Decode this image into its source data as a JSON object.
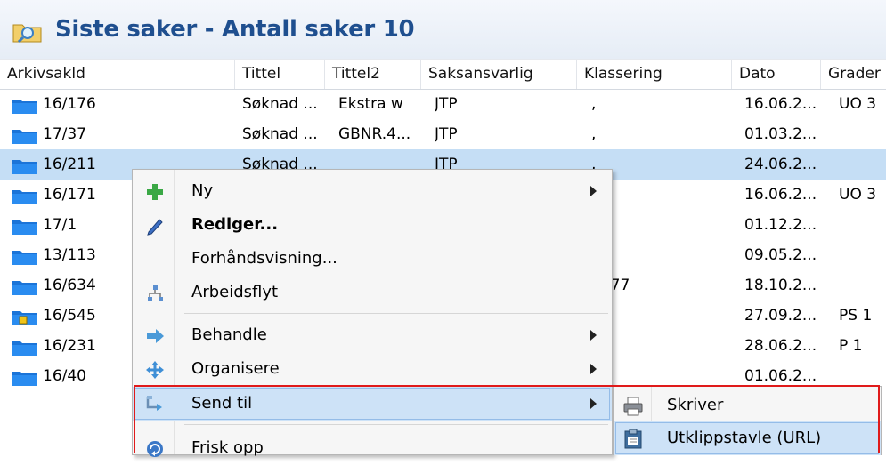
{
  "window": {
    "title": "Siste saker - Antall saker 10",
    "title_icon": "search-folder-icon"
  },
  "table": {
    "columns": [
      "Arkivsakld",
      "Tittel",
      "Tittel2",
      "Saksansvarlig",
      "Klassering",
      "Dato",
      "Grader"
    ],
    "rows": [
      {
        "id": "16/176",
        "tittel": "Søknad ...",
        "tittel2": "Ekstra w",
        "saksansvarlig": "JTP",
        "klassering": ",",
        "dato": "16.06.2...",
        "grader": "UO 3",
        "icon": "folder-icon"
      },
      {
        "id": "17/37",
        "tittel": "Søknad ...",
        "tittel2": "GBNR.4...",
        "saksansvarlig": "JTP",
        "klassering": ",",
        "dato": "01.03.2...",
        "grader": "",
        "icon": "folder-icon"
      },
      {
        "id": "16/211",
        "tittel": "Søknad ...",
        "tittel2": "",
        "saksansvarlig": "JTP",
        "klassering": ",",
        "dato": "24.06.2...",
        "grader": "",
        "icon": "folder-icon",
        "selected": true
      },
      {
        "id": "16/171",
        "tittel": "",
        "tittel2": "",
        "saksansvarlig": "",
        "klassering": "",
        "dato": "16.06.2...",
        "grader": "UO 3",
        "icon": "folder-icon"
      },
      {
        "id": "17/1",
        "tittel": "",
        "tittel2": "",
        "saksansvarlig": "",
        "klassering": "",
        "dato": "01.12.2...",
        "grader": "",
        "icon": "folder-icon"
      },
      {
        "id": "13/113",
        "tittel": "",
        "tittel2": "",
        "saksansvarlig": "",
        "klassering": "",
        "dato": "09.05.2...",
        "grader": "",
        "icon": "folder-icon"
      },
      {
        "id": "16/634",
        "tittel": "",
        "tittel2": "",
        "saksansvarlig": "",
        "klassering": "4, 77",
        "dato": "18.10.2...",
        "grader": "",
        "icon": "folder-icon"
      },
      {
        "id": "16/545",
        "tittel": "",
        "tittel2": "",
        "saksansvarlig": "",
        "klassering": "",
        "dato": "27.09.2...",
        "grader": "PS 1",
        "icon": "locked-folder-icon"
      },
      {
        "id": "16/231",
        "tittel": "",
        "tittel2": "",
        "saksansvarlig": "",
        "klassering": "",
        "dato": "28.06.2...",
        "grader": "P 1",
        "icon": "folder-icon"
      },
      {
        "id": "16/40",
        "tittel": "",
        "tittel2": "",
        "saksansvarlig": "",
        "klassering": "",
        "dato": "01.06.2...",
        "grader": "",
        "icon": "folder-icon"
      }
    ]
  },
  "context_menu": {
    "items": [
      {
        "label": "Ny",
        "icon": "plus-icon",
        "submenu": true
      },
      {
        "label": "Rediger...",
        "icon": "pencil-icon",
        "bold": true
      },
      {
        "label": "Forhåndsvisning...",
        "icon": ""
      },
      {
        "label": "Arbeidsflyt",
        "icon": "workflow-icon"
      },
      {
        "label": "Behandle",
        "icon": "forward-arrow-icon",
        "submenu": true
      },
      {
        "label": "Organisere",
        "icon": "move-arrows-icon",
        "submenu": true
      },
      {
        "label": "Send til",
        "icon": "send-to-icon",
        "submenu": true,
        "highlighted": true
      },
      {
        "label": "Frisk opp",
        "icon": "refresh-icon"
      }
    ]
  },
  "submenu": {
    "items": [
      {
        "label": "Skriver",
        "icon": "printer-icon"
      },
      {
        "label": "Utklippstavle (URL)",
        "icon": "clipboard-icon",
        "highlighted": true
      }
    ]
  },
  "colors": {
    "title_text": "#1f4f8f",
    "selection": "#c5def5",
    "menu_highlight": "#cde2f7",
    "annotation_box": "#e01a1a",
    "folder": "#1b74d8"
  }
}
